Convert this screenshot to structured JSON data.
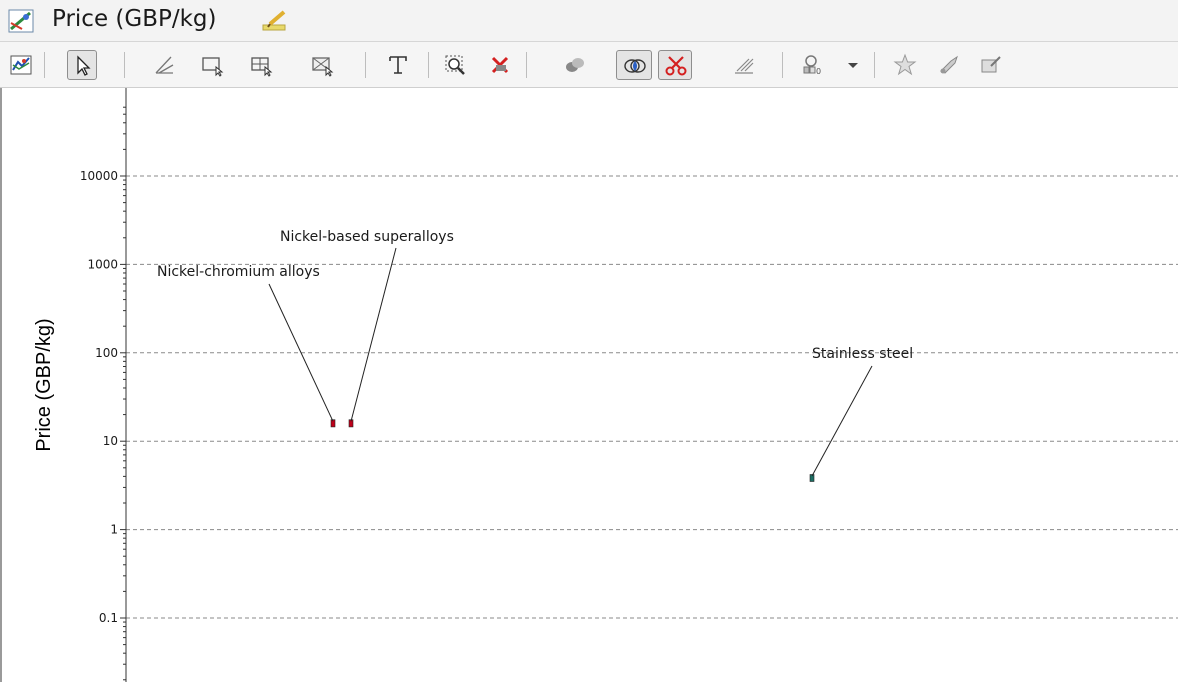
{
  "window": {
    "title": "Price (GBP/kg)",
    "title_icon": "chart-icon",
    "edit_icon": "edit-pencil-icon"
  },
  "toolbar": {
    "buttons": [
      {
        "icon": "chart-settings-icon",
        "pressed": false
      },
      {
        "icon": "select-pointer-icon",
        "pressed": true
      },
      {
        "icon": "line-selection-icon",
        "pressed": false
      },
      {
        "icon": "box-selection-icon",
        "pressed": false
      },
      {
        "icon": "tree-selection-icon",
        "pressed": false
      },
      {
        "icon": "envelope-selection-icon",
        "pressed": false
      },
      {
        "icon": "text-label-icon",
        "pressed": false
      },
      {
        "icon": "zoom-icon",
        "pressed": false
      },
      {
        "icon": "delete-selection-icon",
        "pressed": false
      },
      {
        "icon": "overlap-bubbles-icon",
        "pressed": false
      },
      {
        "icon": "intersection-icon",
        "pressed": true
      },
      {
        "icon": "cut-scissors-icon",
        "pressed": true
      },
      {
        "icon": "hatch-area-icon",
        "pressed": false
      },
      {
        "icon": "find-materials-icon",
        "pressed": false
      },
      {
        "icon": "dropdown-arrow-icon",
        "pressed": false
      },
      {
        "icon": "favorite-star-icon",
        "pressed": false
      },
      {
        "icon": "eraser-icon",
        "pressed": false
      },
      {
        "icon": "export-icon",
        "pressed": false
      }
    ]
  },
  "chart_data": {
    "type": "scatter",
    "title": "",
    "ylabel": "Price (GBP/kg)",
    "xlabel": "",
    "yscale": "log",
    "ylim": [
      0.015,
      60000
    ],
    "yticks": [
      {
        "value": 10000,
        "label": "10000"
      },
      {
        "value": 1000,
        "label": "1000"
      },
      {
        "value": 100,
        "label": "100"
      },
      {
        "value": 10,
        "label": "10"
      },
      {
        "value": 1,
        "label": "1"
      },
      {
        "value": 0.1,
        "label": "0.1"
      }
    ],
    "grid": true,
    "series": [
      {
        "name": "Nickel-chromium alloys",
        "x": 1,
        "ymin": 14.5,
        "ymax": 17.5,
        "color": "#c0001a",
        "label": "Nickel-chromium alloys"
      },
      {
        "name": "Nickel-based superalloys",
        "x": 2,
        "ymin": 14.5,
        "ymax": 17.5,
        "color": "#c0001a",
        "label": "Nickel-based superalloys"
      },
      {
        "name": "Stainless steel",
        "x": 3,
        "ymin": 3.5,
        "ymax": 4.2,
        "color": "#1c6e64",
        "label": "Stainless steel"
      }
    ]
  }
}
